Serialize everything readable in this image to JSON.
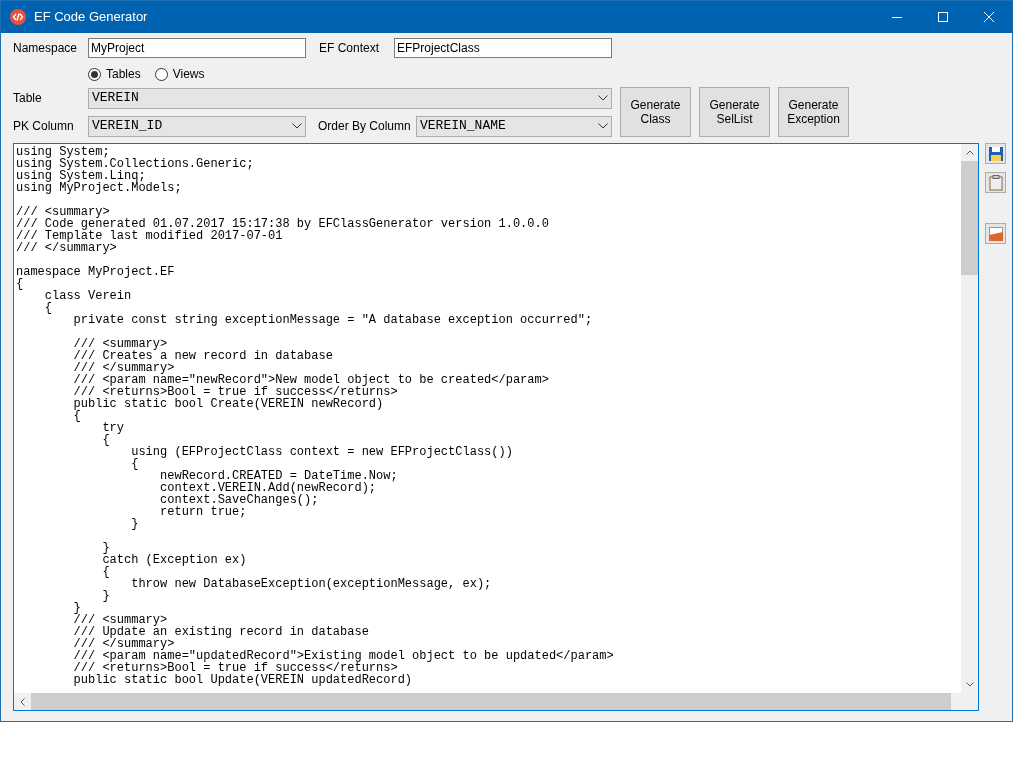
{
  "window": {
    "title": "EF Code Generator"
  },
  "namespace": {
    "label": "Namespace",
    "value": "MyProject"
  },
  "ef_context": {
    "label": "EF Context",
    "value": "EFProjectClass"
  },
  "source_type": [
    {
      "label": "Tables",
      "selected": true
    },
    {
      "label": "Views",
      "selected": false
    }
  ],
  "table": {
    "label": "Table",
    "value": "VEREIN"
  },
  "pk_column": {
    "label": "PK Column",
    "value": "VEREIN_ID"
  },
  "order_by_column": {
    "label": "Order By Column",
    "value": "VEREIN_NAME"
  },
  "buttons": [
    [
      "Generate",
      "Class"
    ],
    [
      "Generate",
      "SelList"
    ],
    [
      "Generate",
      "Exception"
    ]
  ],
  "code_blocks": [
    [
      "using System;",
      "using System.Collections.Generic;",
      "using System.Linq;",
      "using MyProject.Models;"
    ],
    [
      "/// <summary>",
      "/// Code generated 01.07.2017 15:17:38 by EFClassGenerator version 1.0.0.0",
      "/// Template last modified 2017-07-01",
      "/// </summary>"
    ],
    [
      "namespace MyProject.EF",
      "{",
      "    class Verein",
      "    {",
      "        private const string exceptionMessage = \"A database exception occurred\";"
    ],
    [
      "        /// <summary>",
      "        /// Creates a new record in database",
      "        /// </summary>",
      "        /// <param name=\"newRecord\">New model object to be created</param>",
      "        /// <returns>Bool = true if success</returns>",
      "        public static bool Create(VEREIN newRecord)",
      "        {",
      "            try",
      "            {",
      "                using (EFProjectClass context = new EFProjectClass())",
      "                {",
      "                    newRecord.CREATED = DateTime.Now;",
      "                    context.VEREIN.Add(newRecord);",
      "                    context.SaveChanges();",
      "                    return true;",
      "                }"
    ],
    [
      "            }",
      "            catch (Exception ex)",
      "            {",
      "                throw new DatabaseException(exceptionMessage, ex);",
      "            }",
      "        }",
      "        /// <summary>",
      "        /// Update an existing record in database",
      "        /// </summary>",
      "        /// <param name=\"updatedRecord\">Existing model object to be updated</param>",
      "        /// <returns>Bool = true if success</returns>",
      "        public static bool Update(VEREIN updatedRecord)"
    ]
  ]
}
